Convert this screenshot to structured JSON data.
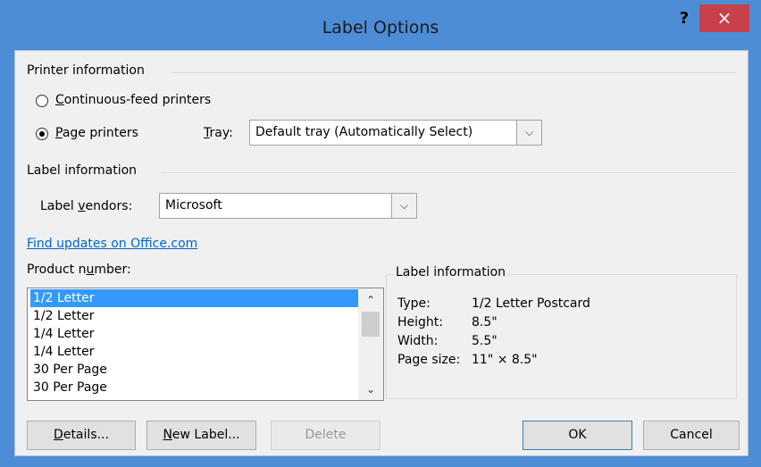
{
  "window": {
    "title": "Label Options",
    "help_label": "?",
    "close_label": "×"
  },
  "printer_info": {
    "group_label": "Printer information",
    "continuous_first": "C",
    "continuous_rest": "ontinuous-feed printers",
    "page_first": "P",
    "page_rest": "age printers",
    "tray_first": "T",
    "tray_rest": "ray:",
    "tray_value": "Default tray (Automatically Select)"
  },
  "label_info": {
    "group_label": "Label information",
    "vendors_pre": "Label ",
    "vendors_key": "v",
    "vendors_post": "endors:",
    "vendors_value": "Microsoft"
  },
  "find_updates": "Find updates on Office.com",
  "product": {
    "label_pre": "Product n",
    "label_key": "u",
    "label_post": "mber:",
    "items": [
      "1/2 Letter",
      "1/2 Letter",
      "1/4 Letter",
      "1/4 Letter",
      "30 Per Page",
      "30 Per Page"
    ]
  },
  "details_box": {
    "title": "Label information",
    "type_key": "Type:",
    "type_value": "1/2 Letter Postcard",
    "height_key": "Height:",
    "height_value": "8.5\"",
    "width_key": "Width:",
    "width_value": "5.5\"",
    "pagesize_key": "Page size:",
    "pagesize_value": "11\" × 8.5\""
  },
  "buttons": {
    "details_key": "D",
    "details_rest": "etails...",
    "new_key": "N",
    "new_rest": "ew Label...",
    "delete": "Delete",
    "ok": "OK",
    "cancel": "Cancel"
  },
  "icons": {
    "radio_off": "radio-unselected-icon",
    "radio_on": "radio-selected-icon",
    "dropdown": "chevron-down-icon",
    "scroll_up": "chevron-up-icon",
    "scroll_down": "chevron-down-icon"
  },
  "colors": {
    "window_frame": "#4c8dd6",
    "close_button": "#c7404a",
    "selection": "#3399ff",
    "link": "#0066cc",
    "dialog_bg": "#f0f0f0"
  }
}
